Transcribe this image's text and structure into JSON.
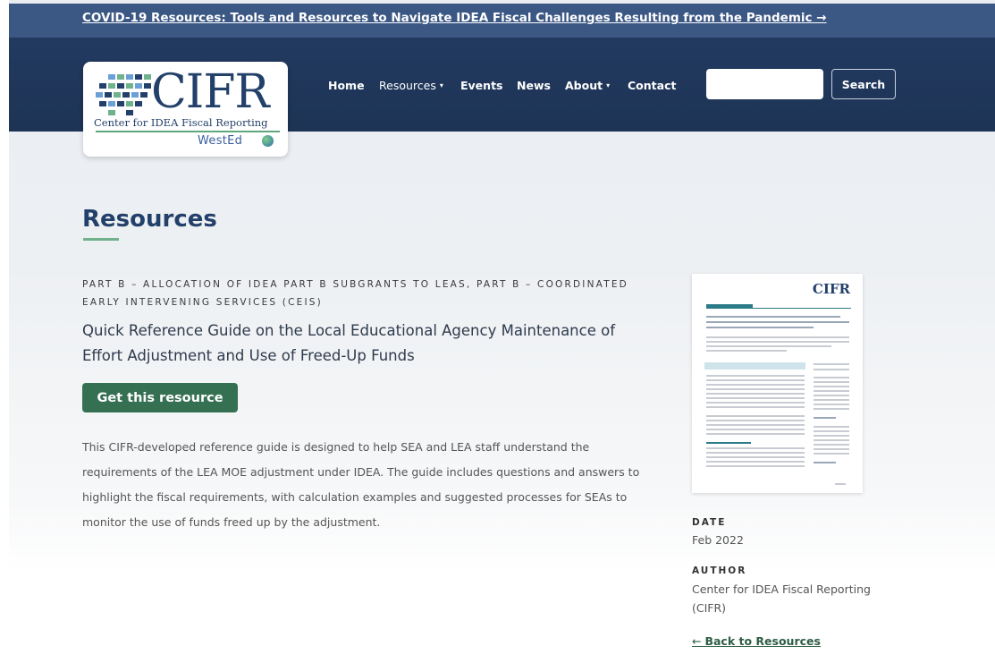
{
  "banner": {
    "text": "COVID-19 Resources: Tools and Resources to Navigate IDEA Fiscal Challenges Resulting from the Pandemic →"
  },
  "logo": {
    "wordmark": "CIFR",
    "subtitle": "Center for IDEA Fiscal Reporting",
    "partner": "WestEd"
  },
  "nav": {
    "items": [
      {
        "label": "Home"
      },
      {
        "label": "Resources",
        "dropdown": true
      },
      {
        "label": "Events"
      },
      {
        "label": "News"
      },
      {
        "label": "About",
        "dropdown": true
      },
      {
        "label": "Contact"
      }
    ],
    "caret": "▾"
  },
  "search": {
    "placeholder": "",
    "button_label": "Search"
  },
  "page": {
    "title": "Resources",
    "category": "Part B – Allocation of IDEA Part B Subgrants to LEAs, Part B – Coordinated Early Intervening Services (CEIS)",
    "resource_title": "Quick Reference Guide on the Local Educational Agency Maintenance of Effort Adjustment and Use of Freed-Up Funds",
    "get_button": "Get this resource",
    "description": "This CIFR-developed reference guide is designed to help SEA and LEA staff understand the requirements of the LEA MOE adjustment under IDEA. The guide includes questions and answers to highlight the fiscal requirements, with calculation examples and suggested processes for SEAs to monitor the use of funds freed up by the adjustment."
  },
  "sidebar": {
    "thumbnail_wordmark": "CIFR",
    "date_label": "DATE",
    "date_value": "Feb 2022",
    "author_label": "AUTHOR",
    "author_value": "Center for IDEA Fiscal Reporting (CIFR)",
    "back_arrow": "←",
    "back_label": "Back to Resources"
  },
  "colors": {
    "banner": "#3b5784",
    "header": "#223a60",
    "accent_green": "#367052",
    "title_blue": "#23406a"
  }
}
